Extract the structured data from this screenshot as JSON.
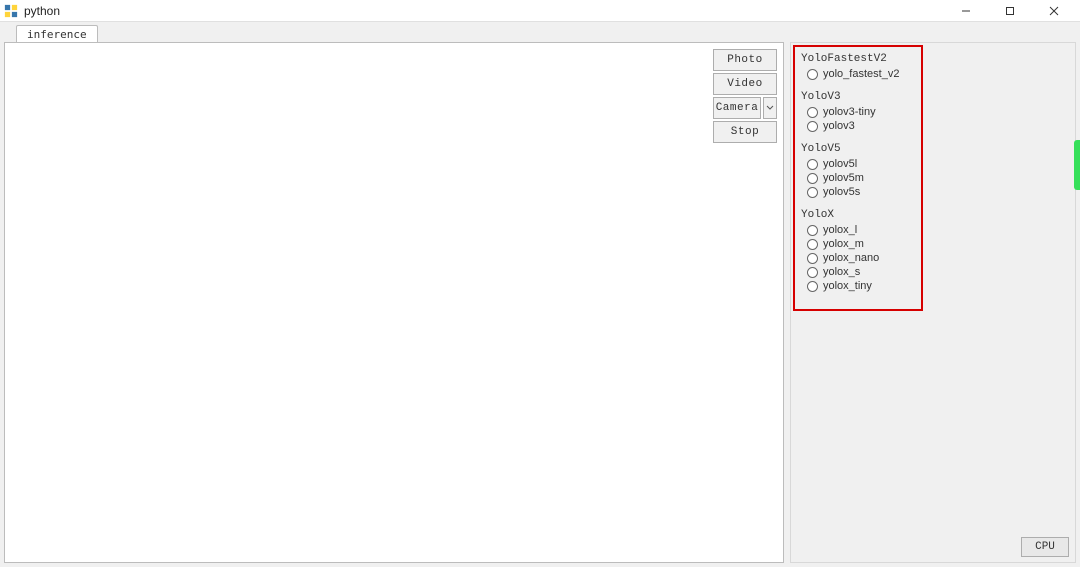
{
  "window": {
    "title": "python"
  },
  "tab": {
    "label": "inference"
  },
  "buttons": {
    "photo": "Photo",
    "video": "Video",
    "camera": "Camera",
    "stop": "Stop"
  },
  "model_groups": [
    {
      "title": "YoloFastestV2",
      "options": [
        "yolo_fastest_v2"
      ]
    },
    {
      "title": "YoloV3",
      "options": [
        "yolov3-tiny",
        "yolov3"
      ]
    },
    {
      "title": "YoloV5",
      "options": [
        "yolov5l",
        "yolov5m",
        "yolov5s"
      ]
    },
    {
      "title": "YoloX",
      "options": [
        "yolox_l",
        "yolox_m",
        "yolox_nano",
        "yolox_s",
        "yolox_tiny"
      ]
    }
  ],
  "footer": {
    "device": "CPU"
  }
}
